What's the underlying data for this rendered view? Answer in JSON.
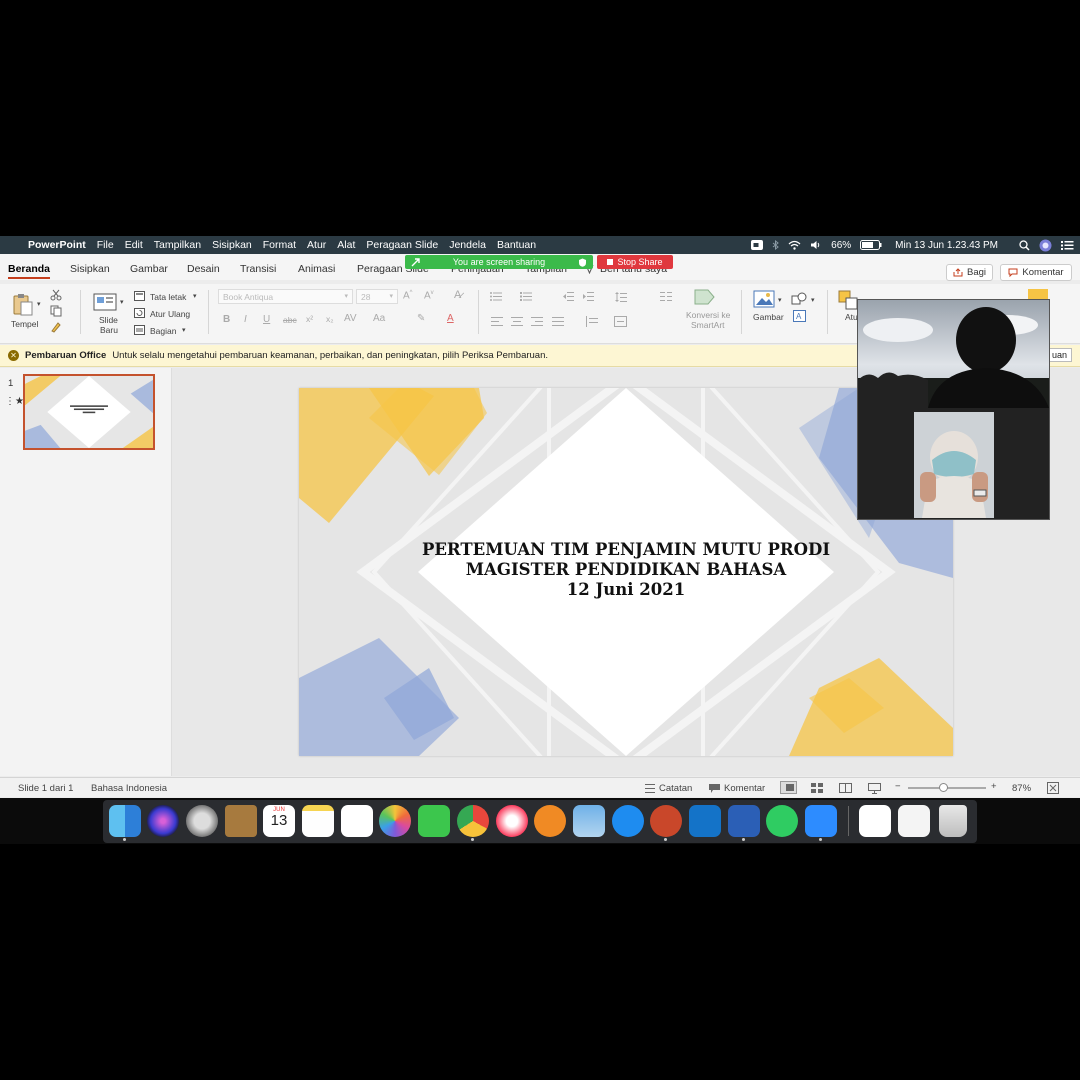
{
  "menubar": {
    "app_name": "PowerPoint",
    "items": [
      "File",
      "Edit",
      "Tampilkan",
      "Sisipkan",
      "Format",
      "Atur",
      "Alat",
      "Peragaan Slide",
      "Jendela",
      "Bantuan"
    ],
    "battery": "66%",
    "datetime": "Min 13 Jun  1.23.43 PM"
  },
  "zoom": {
    "sharing_text": "You are screen sharing",
    "stop_label": "Stop Share"
  },
  "tabs": {
    "items": [
      "Beranda",
      "Sisipkan",
      "Gambar",
      "Desain",
      "Transisi",
      "Animasi",
      "Peragaan Slide",
      "Peninjauan",
      "Tampilan",
      "Beri tahu saya"
    ],
    "share_label": "Bagi",
    "comment_label": "Komentar"
  },
  "ribbon": {
    "paste_label": "Tempel",
    "new_slide_line1": "Slide",
    "new_slide_line2": "Baru",
    "layout_label": "Tata letak",
    "reset_label": "Atur Ulang",
    "section_label": "Bagian",
    "font_name": "Book Antiqua",
    "font_size": "28",
    "smartart_line1": "Konversi ke",
    "smartart_line2": "SmartArt",
    "picture_label": "Gambar",
    "arrange_label": "Atu"
  },
  "notification": {
    "title": "Pembaruan Office",
    "message": "Untuk selalu mengetahui pembaruan keamanan, perbaikan, dan peningkatan, pilih Periksa Pembaruan.",
    "button_fragment": "uan"
  },
  "thumbnail": {
    "slide_number": "1"
  },
  "slide": {
    "line1": "PERTEMUAN TIM PENJAMIN MUTU PRODI",
    "line2": "MAGISTER PENDIDIKAN BAHASA",
    "line3": "12 Juni 2021"
  },
  "status": {
    "slide_position": "Slide 1 dari 1",
    "language": "Bahasa Indonesia",
    "notes_label": "Catatan",
    "comments_label": "Komentar",
    "zoom_level": "87%",
    "zoom_fraction": 0.45
  },
  "dock": {
    "calendar_month": "JUN",
    "calendar_day": "13",
    "apps": [
      "finder-icon",
      "siri-icon",
      "launchpad-icon",
      "contacts-icon",
      "calendar-icon",
      "notes-icon",
      "reminders-icon",
      "photos-icon",
      "facetime-icon",
      "chrome-icon",
      "music-icon",
      "books-icon",
      "preview-icon",
      "appstore-icon",
      "powerpoint-icon",
      "outlook-icon",
      "word-icon",
      "whatsapp-icon",
      "zoom-icon",
      "keynote-icon",
      "pages-icon",
      "trash-icon"
    ]
  },
  "colors": {
    "menubar": "#2b3a43",
    "accent": "#c43e1c",
    "share_green": "#3bba4a",
    "stop_red": "#e0383e",
    "slide_yellow": "#f6c445",
    "slide_blue": "#8fa6d8"
  }
}
